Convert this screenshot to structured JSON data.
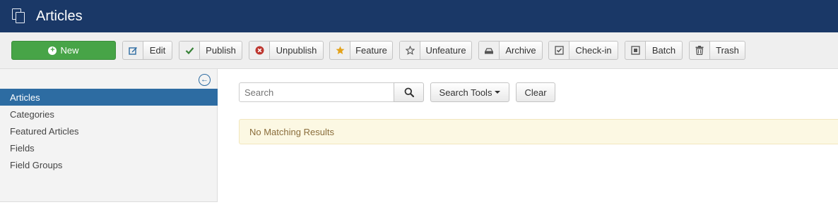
{
  "header": {
    "title": "Articles",
    "icon": "copy-icon"
  },
  "toolbar": {
    "new_label": "New",
    "buttons": [
      {
        "label": "Edit",
        "icon": "edit-icon",
        "color": "#2d6ca2"
      },
      {
        "label": "Publish",
        "icon": "check-icon",
        "color": "#378137"
      },
      {
        "label": "Unpublish",
        "icon": "unpublish-icon",
        "color": "#bd362f"
      },
      {
        "label": "Feature",
        "icon": "star-icon",
        "color": "#e3a21a"
      },
      {
        "label": "Unfeature",
        "icon": "star-empty-icon",
        "color": "#555555"
      },
      {
        "label": "Archive",
        "icon": "archive-icon",
        "color": "#555555"
      },
      {
        "label": "Check-in",
        "icon": "checkin-icon",
        "color": "#555555"
      },
      {
        "label": "Batch",
        "icon": "batch-icon",
        "color": "#555555"
      },
      {
        "label": "Trash",
        "icon": "trash-icon",
        "color": "#555555"
      }
    ]
  },
  "sidebar": {
    "items": [
      {
        "label": "Articles",
        "active": true
      },
      {
        "label": "Categories",
        "active": false
      },
      {
        "label": "Featured Articles",
        "active": false
      },
      {
        "label": "Fields",
        "active": false
      },
      {
        "label": "Field Groups",
        "active": false
      }
    ]
  },
  "filters": {
    "search_placeholder": "Search",
    "search_tools_label": "Search Tools",
    "clear_label": "Clear"
  },
  "alert": {
    "message": "No Matching Results"
  },
  "colors": {
    "header_bg": "#1a3867",
    "primary": "#2d6ca2",
    "success": "#47a447"
  }
}
